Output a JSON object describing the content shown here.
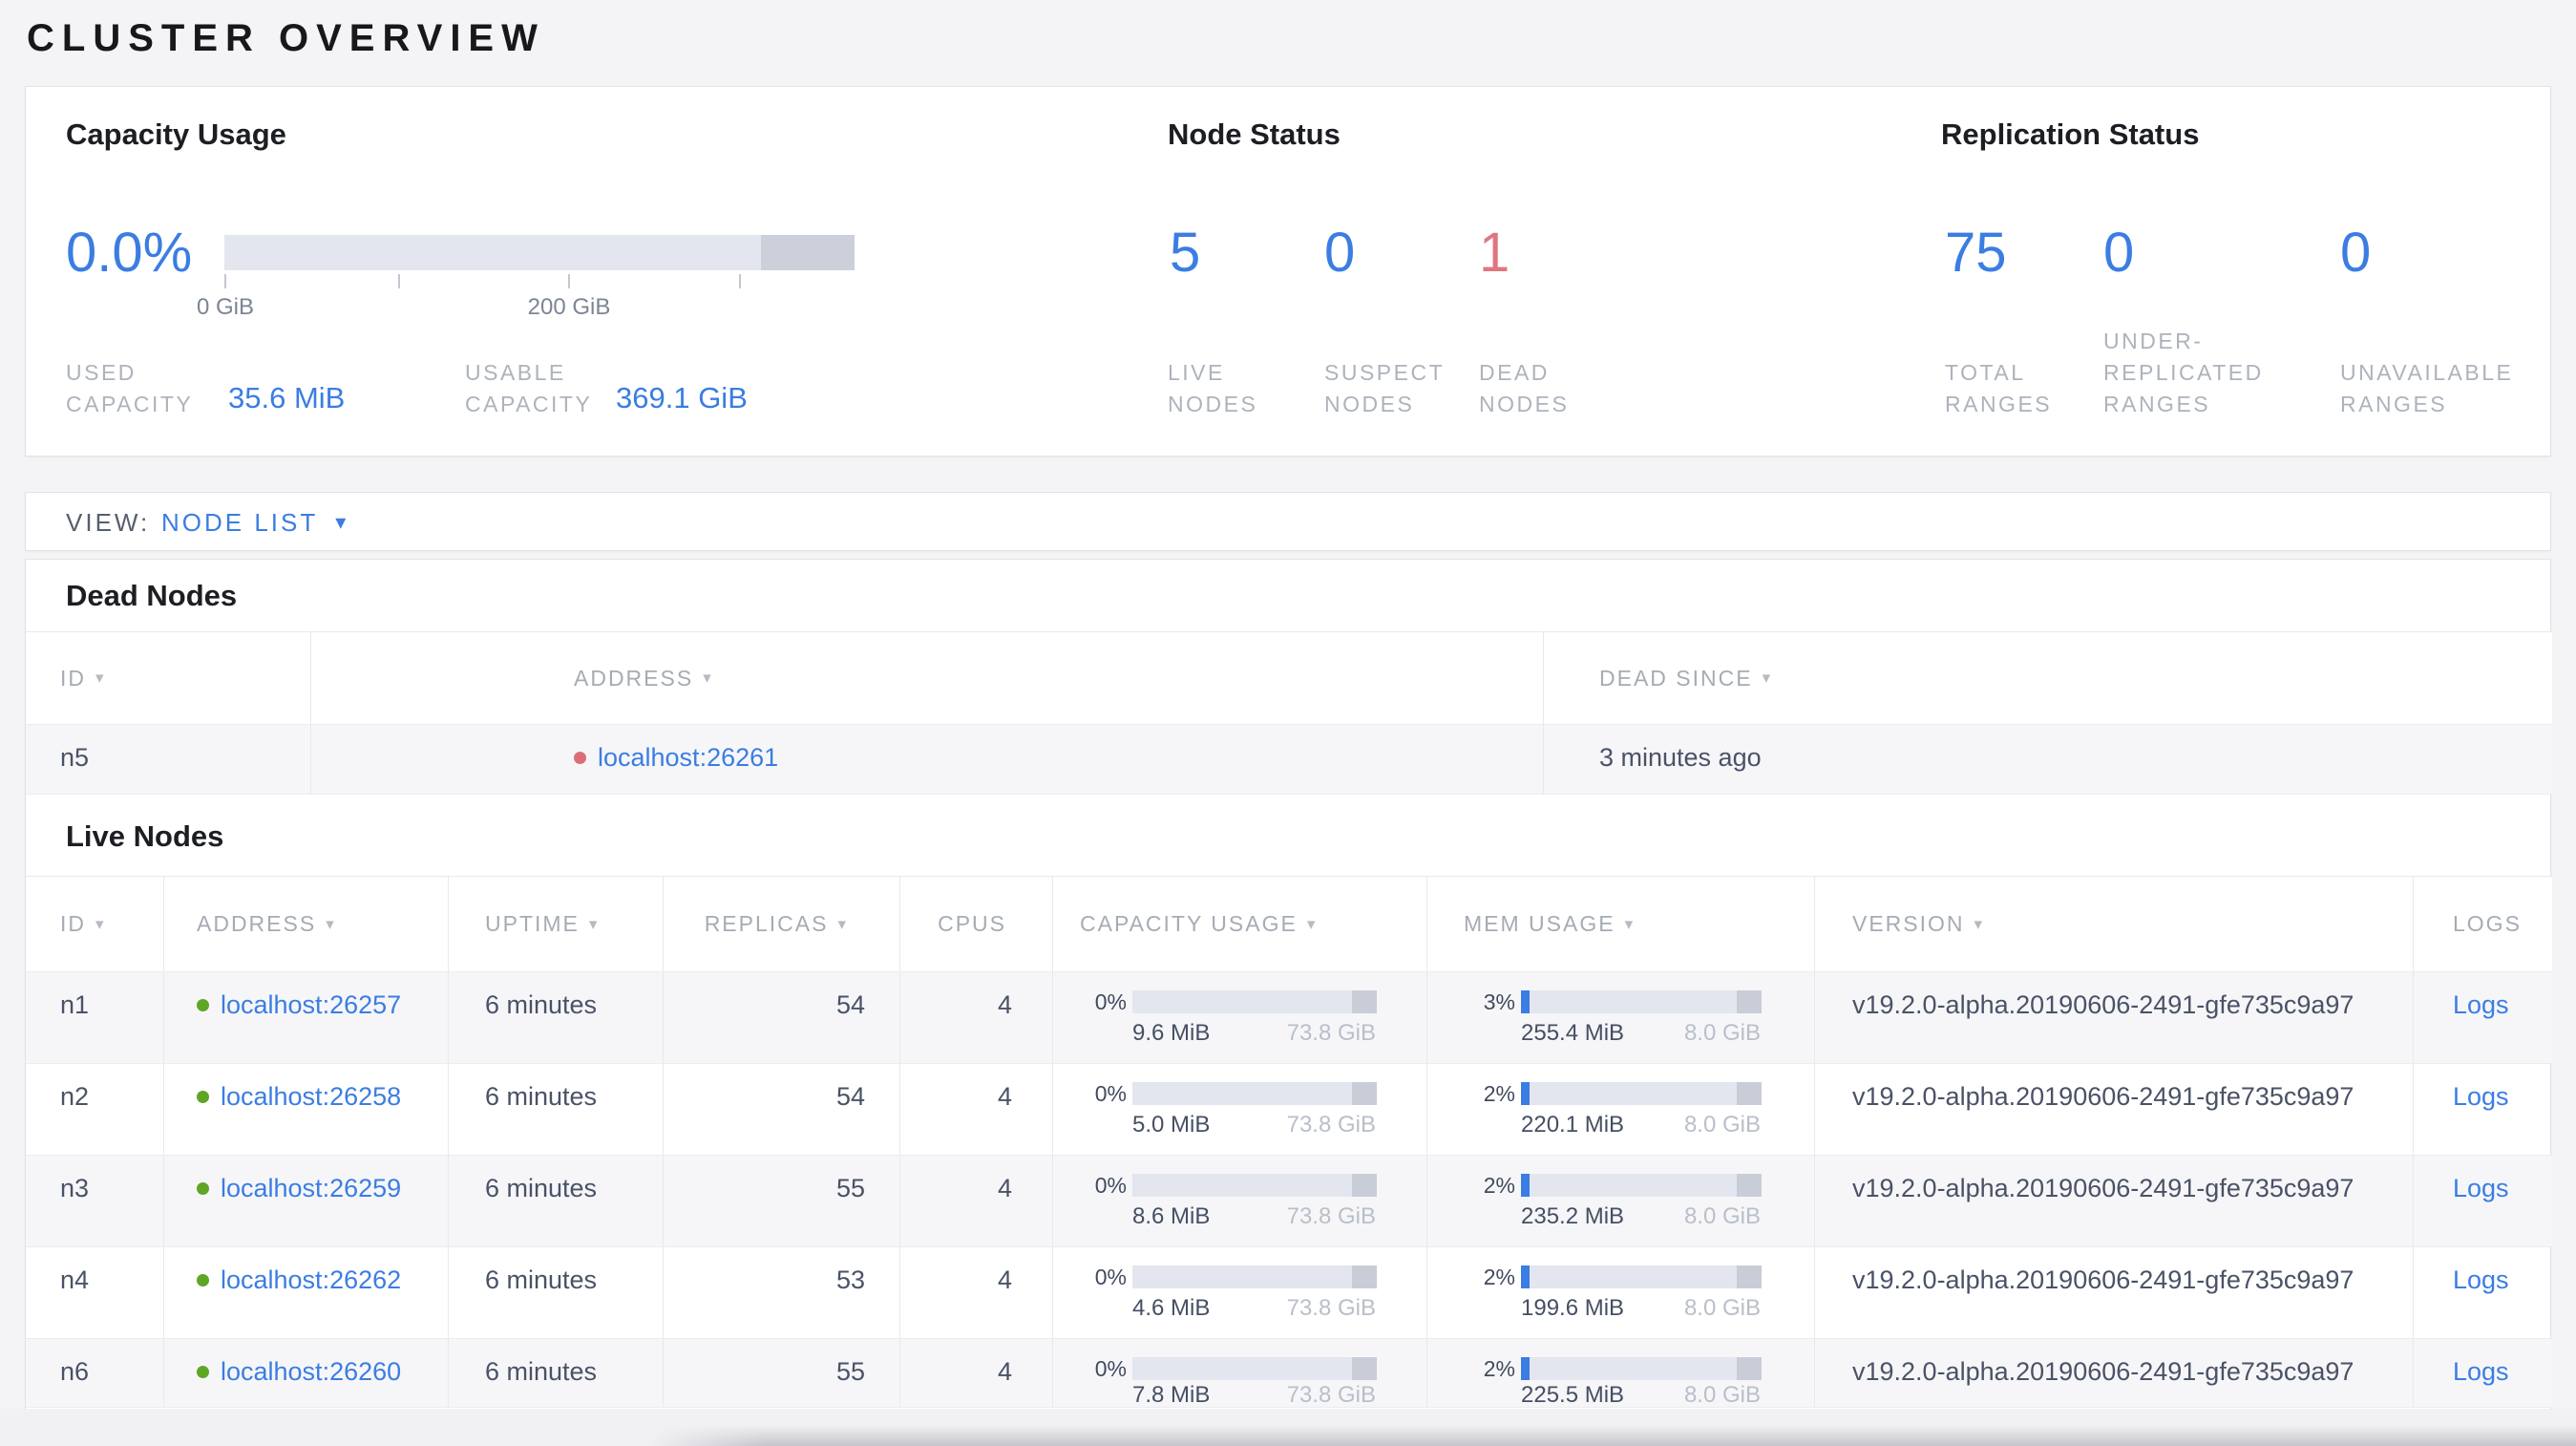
{
  "colors": {
    "accent_blue": "#3b7de2",
    "danger_red": "#e0767f",
    "live_green": "#5fa624",
    "dead_dot_red": "#de6e76",
    "bar_track": "#e3e6ee",
    "bar_endcap": "#c9cdd8"
  },
  "page": {
    "title": "CLUSTER OVERVIEW"
  },
  "overview": {
    "capacity": {
      "title": "Capacity Usage",
      "percent": "0.0%",
      "percent_num": 0,
      "tick_labels": [
        "0 GiB",
        "200 GiB"
      ],
      "used": {
        "label": "USED\nCAPACITY",
        "value": "35.6 MiB"
      },
      "usable": {
        "label": "USABLE\nCAPACITY",
        "value": "369.1 GiB"
      }
    },
    "node_status": {
      "title": "Node Status",
      "stats": [
        {
          "value": "5",
          "label": "LIVE\nNODES"
        },
        {
          "value": "0",
          "label": "SUSPECT\nNODES"
        },
        {
          "value": "1",
          "label": "DEAD\nNODES"
        }
      ]
    },
    "replication": {
      "title": "Replication Status",
      "stats": [
        {
          "value": "75",
          "label": "TOTAL\nRANGES"
        },
        {
          "value": "0",
          "label": "UNDER-\nREPLICATED\nRANGES"
        },
        {
          "value": "0",
          "label": "UNAVAILABLE\nRANGES"
        }
      ]
    }
  },
  "view_bar": {
    "label": "VIEW:",
    "selected": "NODE LIST"
  },
  "dead_nodes": {
    "title": "Dead Nodes",
    "headers": {
      "id": "ID",
      "address": "ADDRESS",
      "dead_since": "DEAD SINCE"
    },
    "rows": [
      {
        "id": "n5",
        "address": "localhost:26261",
        "dead_since": "3 minutes ago"
      }
    ]
  },
  "live_nodes": {
    "title": "Live Nodes",
    "headers": {
      "id": "ID",
      "address": "ADDRESS",
      "uptime": "UPTIME",
      "replicas": "REPLICAS",
      "cpus": "CPUS",
      "capacity": "CAPACITY USAGE",
      "mem": "MEM USAGE",
      "version": "VERSION",
      "logs": "LOGS"
    },
    "rows": [
      {
        "id": "n1",
        "address": "localhost:26257",
        "uptime": "6 minutes",
        "replicas": "54",
        "cpus": "4",
        "cap": {
          "pct": "0%",
          "pct_num": 0,
          "used": "9.6 MiB",
          "total": "73.8 GiB"
        },
        "mem": {
          "pct": "3%",
          "pct_num": 3,
          "used": "255.4 MiB",
          "total": "8.0 GiB"
        },
        "version": "v19.2.0-alpha.20190606-2491-gfe735c9a97",
        "logs": "Logs"
      },
      {
        "id": "n2",
        "address": "localhost:26258",
        "uptime": "6 minutes",
        "replicas": "54",
        "cpus": "4",
        "cap": {
          "pct": "0%",
          "pct_num": 0,
          "used": "5.0 MiB",
          "total": "73.8 GiB"
        },
        "mem": {
          "pct": "2%",
          "pct_num": 2,
          "used": "220.1 MiB",
          "total": "8.0 GiB"
        },
        "version": "v19.2.0-alpha.20190606-2491-gfe735c9a97",
        "logs": "Logs"
      },
      {
        "id": "n3",
        "address": "localhost:26259",
        "uptime": "6 minutes",
        "replicas": "55",
        "cpus": "4",
        "cap": {
          "pct": "0%",
          "pct_num": 0,
          "used": "8.6 MiB",
          "total": "73.8 GiB"
        },
        "mem": {
          "pct": "2%",
          "pct_num": 2,
          "used": "235.2 MiB",
          "total": "8.0 GiB"
        },
        "version": "v19.2.0-alpha.20190606-2491-gfe735c9a97",
        "logs": "Logs"
      },
      {
        "id": "n4",
        "address": "localhost:26262",
        "uptime": "6 minutes",
        "replicas": "53",
        "cpus": "4",
        "cap": {
          "pct": "0%",
          "pct_num": 0,
          "used": "4.6 MiB",
          "total": "73.8 GiB"
        },
        "mem": {
          "pct": "2%",
          "pct_num": 2,
          "used": "199.6 MiB",
          "total": "8.0 GiB"
        },
        "version": "v19.2.0-alpha.20190606-2491-gfe735c9a97",
        "logs": "Logs"
      },
      {
        "id": "n6",
        "address": "localhost:26260",
        "uptime": "6 minutes",
        "replicas": "55",
        "cpus": "4",
        "cap": {
          "pct": "0%",
          "pct_num": 0,
          "used": "7.8 MiB",
          "total": "73.8 GiB"
        },
        "mem": {
          "pct": "2%",
          "pct_num": 2,
          "used": "225.5 MiB",
          "total": "8.0 GiB"
        },
        "version": "v19.2.0-alpha.20190606-2491-gfe735c9a97",
        "logs": "Logs"
      }
    ]
  }
}
